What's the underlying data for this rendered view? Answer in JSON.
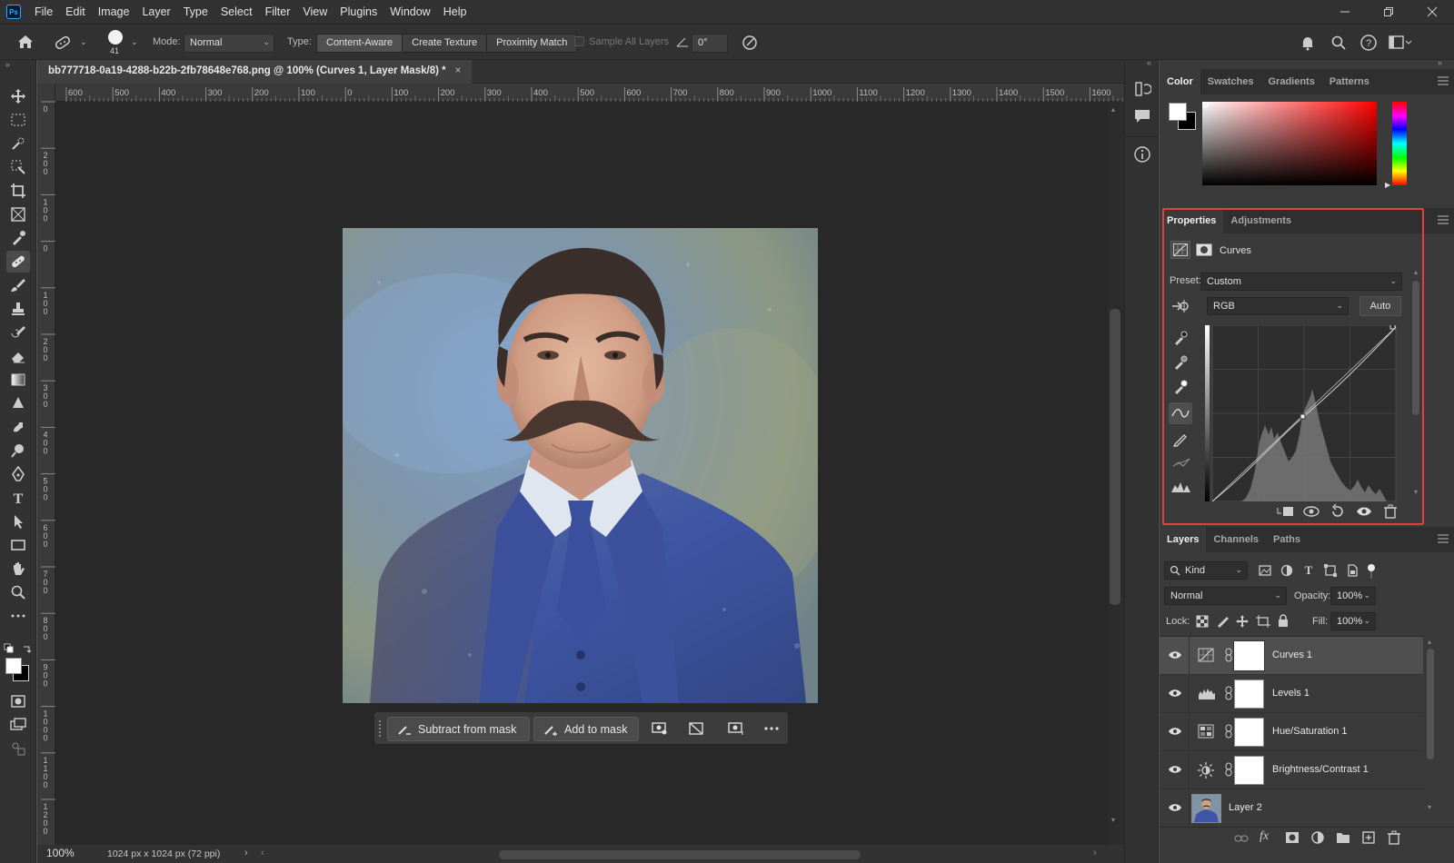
{
  "app": {
    "logo": "Ps"
  },
  "menu": [
    "File",
    "Edit",
    "Image",
    "Layer",
    "Type",
    "Select",
    "Filter",
    "View",
    "Plugins",
    "Window",
    "Help"
  ],
  "options_bar": {
    "brush_size": "41",
    "mode_label": "Mode:",
    "mode_value": "Normal",
    "type_label": "Type:",
    "type_options": [
      "Content-Aware",
      "Create Texture",
      "Proximity Match"
    ],
    "sample_all_layers": "Sample All Layers",
    "angle_value": "0°"
  },
  "document": {
    "tab_title": "bb777718-0a19-4288-b22b-2fb78648e768.png @ 100% (Curves 1, Layer Mask/8) *",
    "ruler_labels": [
      "600",
      "500",
      "400",
      "300",
      "200",
      "100",
      "0",
      "100",
      "200",
      "300",
      "400",
      "500",
      "600",
      "700",
      "800",
      "900",
      "1000",
      "1100",
      "1200",
      "1300",
      "1400",
      "1500",
      "1600"
    ],
    "vruler_labels": [
      "0",
      "2 0 0",
      "1 0 0",
      "0",
      "1 0 0",
      "2 0 0",
      "3 0 0",
      "4 0 0",
      "5 0 0",
      "6 0 0",
      "7 0 0",
      "8 0 0",
      "9 0 0",
      "1 0 0 0",
      "1 1 0 0",
      "1 2 0 0"
    ],
    "zoom": "100%",
    "doc_info": "1024 px x 1024 px (72 ppi)"
  },
  "context_bar": {
    "subtract_label": "Subtract from mask",
    "add_label": "Add to mask"
  },
  "color_panel": {
    "tabs": [
      "Color",
      "Swatches",
      "Gradients",
      "Patterns"
    ],
    "active_tab": "Color"
  },
  "properties_panel": {
    "tabs": [
      "Properties",
      "Adjustments"
    ],
    "title": "Curves",
    "preset_label": "Preset:",
    "preset_value": "Custom",
    "channel_value": "RGB",
    "auto_label": "Auto"
  },
  "layers_panel": {
    "tabs": [
      "Layers",
      "Channels",
      "Paths"
    ],
    "filter_value": "Kind",
    "blend_mode": "Normal",
    "opacity_label": "Opacity:",
    "opacity_value": "100%",
    "lock_label": "Lock:",
    "fill_label": "Fill:",
    "fill_value": "100%",
    "layers": [
      {
        "name": "Curves 1",
        "icon": "curves-icon"
      },
      {
        "name": "Levels 1",
        "icon": "levels-icon"
      },
      {
        "name": "Hue/Saturation 1",
        "icon": "hue-saturation-icon"
      },
      {
        "name": "Brightness/Contrast 1",
        "icon": "brightness-contrast-icon"
      },
      {
        "name": "Layer 2",
        "icon": "image-thumbnail"
      }
    ]
  },
  "colors": {
    "accent_highlight": "#e14141",
    "panel_bg": "#3a3a3a",
    "canvas_bg": "#282828"
  }
}
